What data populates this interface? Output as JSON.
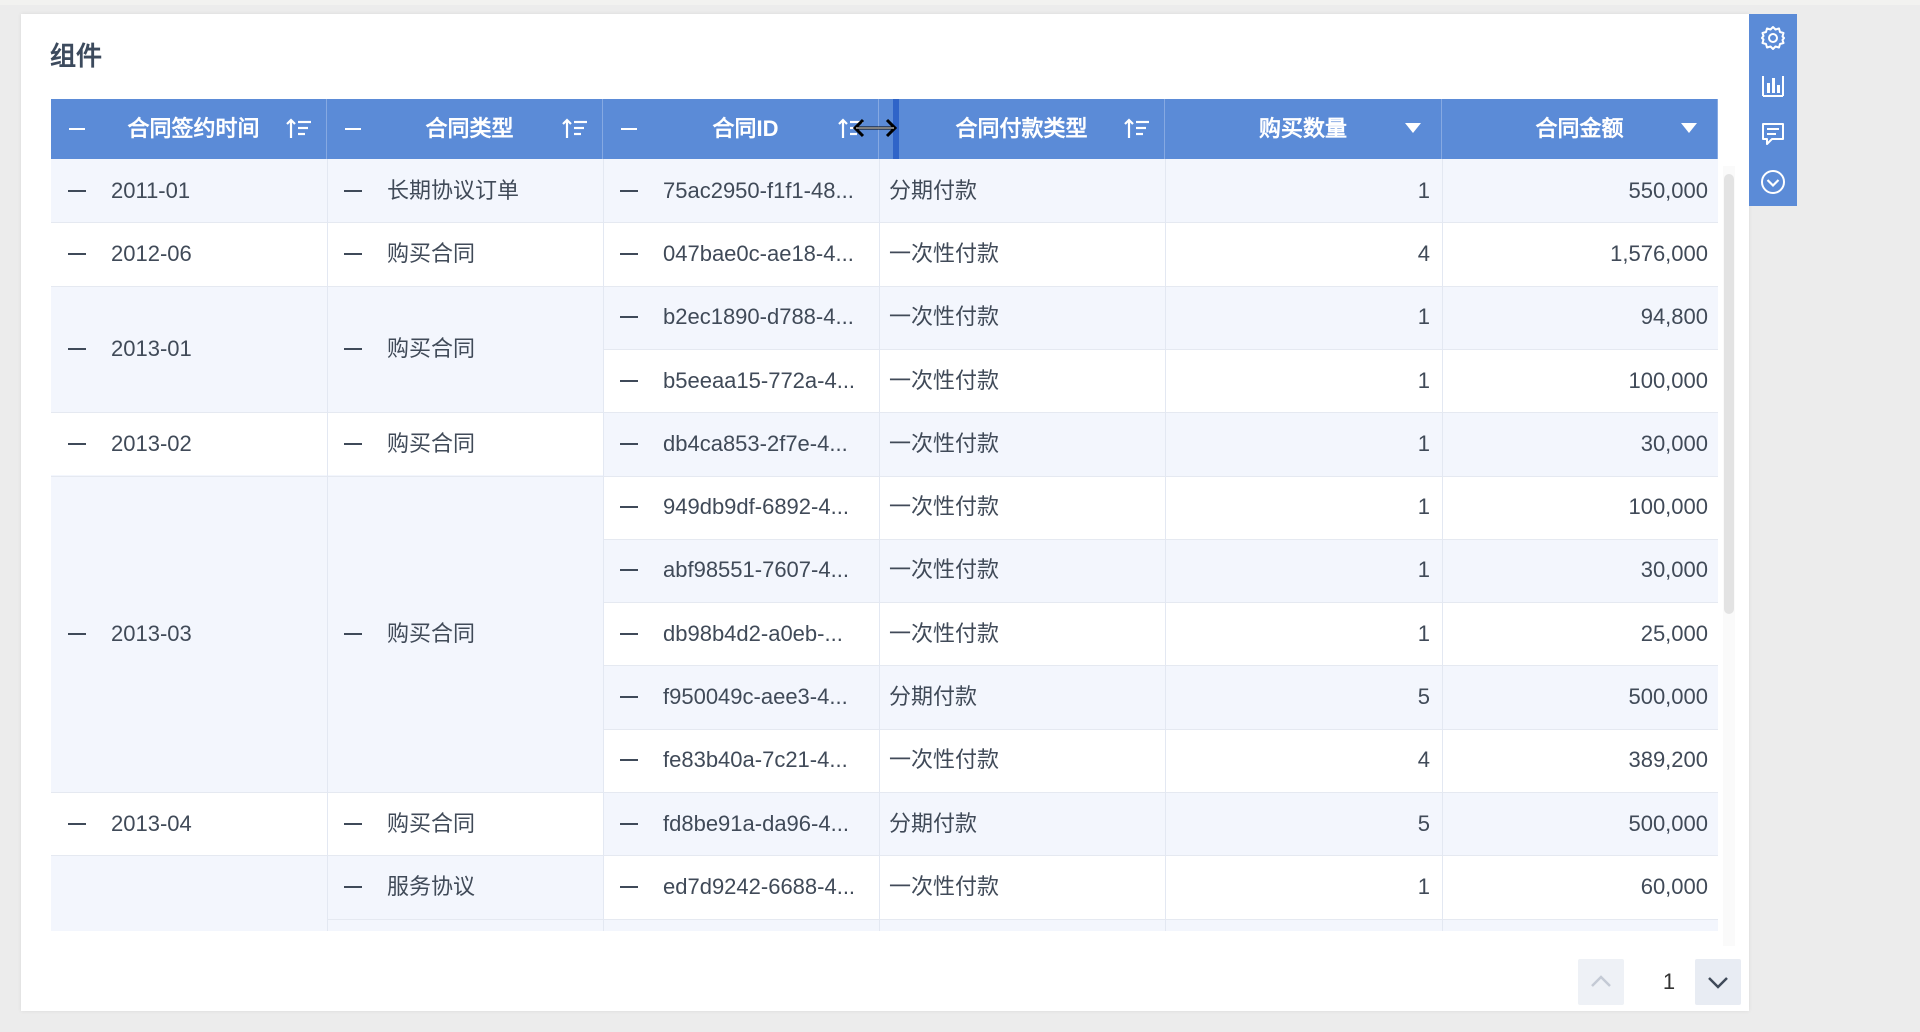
{
  "panel": {
    "title": "组件"
  },
  "columns": [
    {
      "label": "合同签约时间",
      "control": "sort"
    },
    {
      "label": "合同类型",
      "control": "sort"
    },
    {
      "label": "合同ID",
      "control": "sort"
    },
    {
      "label": "合同付款类型",
      "control": "sort"
    },
    {
      "label": "购买数量",
      "control": "filter"
    },
    {
      "label": "合同金额",
      "control": "filter"
    }
  ],
  "rows": [
    {
      "date": "2011-01",
      "type": "长期协议订单",
      "id": "75ac2950-f1f1-48...",
      "pay": "分期付款",
      "qty": "1",
      "amount": "550,000"
    },
    {
      "date": "2012-06",
      "type": "购买合同",
      "id": "047bae0c-ae18-4...",
      "pay": "一次性付款",
      "qty": "4",
      "amount": "1,576,000"
    },
    {
      "date": "2013-01",
      "type": "购买合同",
      "id": "b2ec1890-d788-4...",
      "pay": "一次性付款",
      "qty": "1",
      "amount": "94,800"
    },
    {
      "date": "",
      "type": "",
      "id": "b5eeaa15-772a-4...",
      "pay": "一次性付款",
      "qty": "1",
      "amount": "100,000"
    },
    {
      "date": "2013-02",
      "type": "购买合同",
      "id": "db4ca853-2f7e-4...",
      "pay": "一次性付款",
      "qty": "1",
      "amount": "30,000"
    },
    {
      "date": "2013-03",
      "type": "购买合同",
      "id": "949db9df-6892-4...",
      "pay": "一次性付款",
      "qty": "1",
      "amount": "100,000"
    },
    {
      "date": "",
      "type": "",
      "id": "abf98551-7607-4...",
      "pay": "一次性付款",
      "qty": "1",
      "amount": "30,000"
    },
    {
      "date": "",
      "type": "",
      "id": "db98b4d2-a0eb-...",
      "pay": "一次性付款",
      "qty": "1",
      "amount": "25,000"
    },
    {
      "date": "",
      "type": "",
      "id": "f950049c-aee3-4...",
      "pay": "分期付款",
      "qty": "5",
      "amount": "500,000"
    },
    {
      "date": "",
      "type": "",
      "id": "fe83b40a-7c21-4...",
      "pay": "一次性付款",
      "qty": "4",
      "amount": "389,200"
    },
    {
      "date": "2013-04",
      "type": "购买合同",
      "id": "fd8be91a-da96-4...",
      "pay": "分期付款",
      "qty": "5",
      "amount": "500,000"
    },
    {
      "date": "",
      "type": "服务协议",
      "id": "ed7d9242-6688-4...",
      "pay": "一次性付款",
      "qty": "1",
      "amount": "60,000"
    }
  ],
  "groups": {
    "date": [
      {
        "label": "2011-01",
        "start": 0,
        "span": 1
      },
      {
        "label": "2012-06",
        "start": 1,
        "span": 1
      },
      {
        "label": "2013-01",
        "start": 2,
        "span": 2
      },
      {
        "label": "2013-02",
        "start": 4,
        "span": 1
      },
      {
        "label": "2013-03",
        "start": 5,
        "span": 5
      },
      {
        "label": "2013-04",
        "start": 10,
        "span": 1
      },
      {
        "label": "",
        "start": 11,
        "span": 2
      }
    ],
    "type": [
      {
        "label": "长期协议订单",
        "start": 0,
        "span": 1
      },
      {
        "label": "购买合同",
        "start": 1,
        "span": 1
      },
      {
        "label": "购买合同",
        "start": 2,
        "span": 2
      },
      {
        "label": "购买合同",
        "start": 4,
        "span": 1
      },
      {
        "label": "购买合同",
        "start": 5,
        "span": 5
      },
      {
        "label": "购买合同",
        "start": 10,
        "span": 1
      },
      {
        "label": "服务协议",
        "start": 11,
        "span": 1
      }
    ]
  },
  "pager": {
    "current": "1"
  },
  "toolbar": [
    "gear-icon",
    "chart-bars-icon",
    "comment-icon",
    "chevron-circle-down-icon"
  ],
  "colors": {
    "header": "#5b8bd7",
    "accent": "#2f64c8",
    "row_alt": "#f3f6fd"
  }
}
